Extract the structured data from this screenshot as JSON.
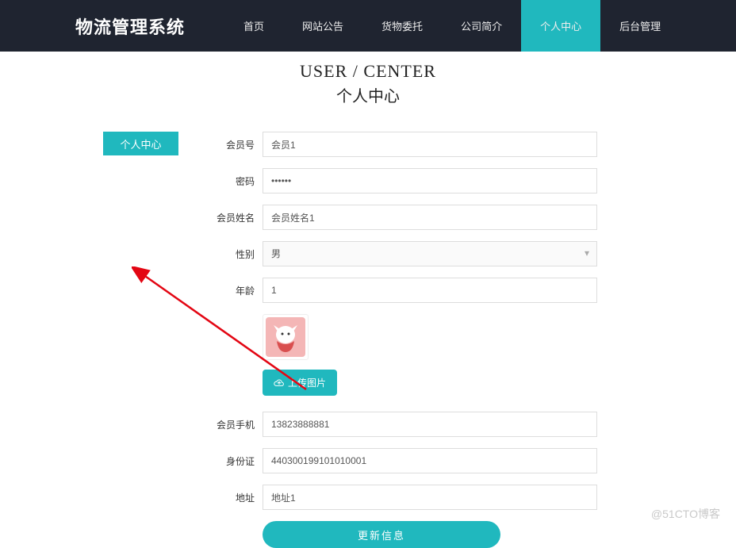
{
  "navbar": {
    "brand": "物流管理系统",
    "items": [
      {
        "label": "首页"
      },
      {
        "label": "网站公告"
      },
      {
        "label": "货物委托"
      },
      {
        "label": "公司简介"
      },
      {
        "label": "个人中心"
      },
      {
        "label": "后台管理"
      }
    ]
  },
  "header": {
    "title_en": "USER / CENTER",
    "title_zh": "个人中心"
  },
  "sidebar": {
    "active_label": "个人中心"
  },
  "form": {
    "member_id": {
      "label": "会员号",
      "value": "会员1"
    },
    "password": {
      "label": "密码",
      "value": "••••••"
    },
    "member_name": {
      "label": "会员姓名",
      "value": "会员姓名1"
    },
    "gender": {
      "label": "性别",
      "value": "男"
    },
    "age": {
      "label": "年龄",
      "value": "1"
    },
    "upload_label": "上传图片",
    "phone": {
      "label": "会员手机",
      "value": "13823888881"
    },
    "id_card": {
      "label": "身份证",
      "value": "440300199101010001"
    },
    "address": {
      "label": "地址",
      "value": "地址1"
    },
    "submit_label": "更新信息"
  },
  "watermark": "@51CTO博客"
}
